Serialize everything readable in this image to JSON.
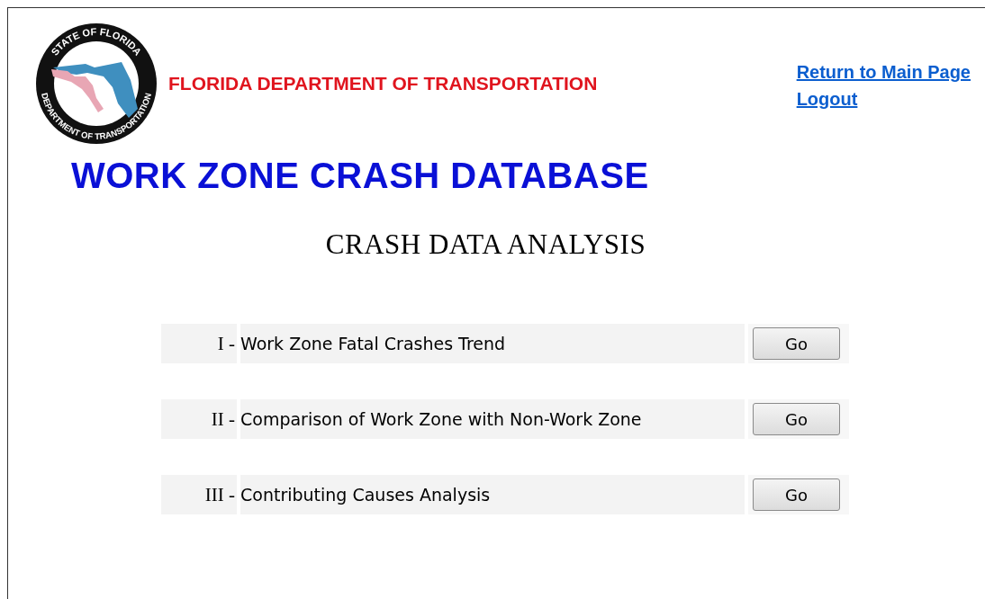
{
  "header": {
    "seal": {
      "top_text": "STATE OF FLORIDA",
      "bottom_text": "DEPARTMENT OF TRANSPORTATION"
    },
    "agency": "FLORIDA DEPARTMENT OF TRANSPORTATION",
    "links": [
      "Return to Main Page",
      "Logout"
    ]
  },
  "title": "WORK ZONE CRASH DATABASE",
  "subtitle": "CRASH DATA ANALYSIS",
  "analyses": [
    {
      "number": "I -",
      "label": "Work Zone Fatal Crashes Trend",
      "button": "Go"
    },
    {
      "number": "II -",
      "label": "Comparison of Work Zone with Non-Work Zone",
      "button": "Go"
    },
    {
      "number": "III -",
      "label": "Contributing Causes Analysis",
      "button": "Go"
    }
  ]
}
